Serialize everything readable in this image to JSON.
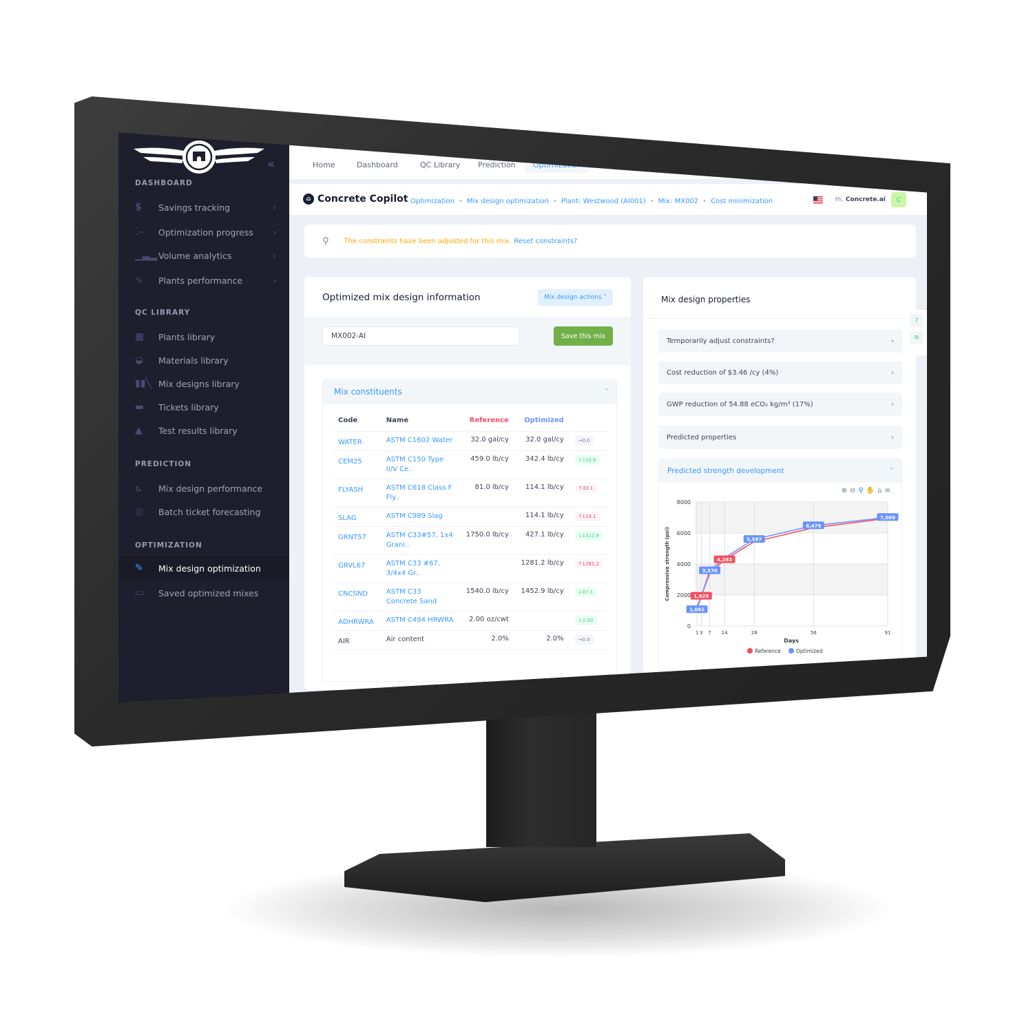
{
  "sidebar": {
    "sections": [
      {
        "title": "DASHBOARD",
        "items": [
          {
            "label": "Savings tracking",
            "icon": "dollar-icon",
            "chevron": true
          },
          {
            "label": "Optimization progress",
            "icon": "progress-icon",
            "chevron": true
          },
          {
            "label": "Volume analytics",
            "icon": "bar-chart-icon",
            "chevron": true
          },
          {
            "label": "Plants performance",
            "icon": "pulse-icon",
            "chevron": true
          }
        ]
      },
      {
        "title": "QC LIBRARY",
        "items": [
          {
            "label": "Plants library",
            "icon": "building-icon"
          },
          {
            "label": "Materials library",
            "icon": "bowl-icon"
          },
          {
            "label": "Mix designs library",
            "icon": "books-icon"
          },
          {
            "label": "Tickets library",
            "icon": "ticket-icon"
          },
          {
            "label": "Test results library",
            "icon": "cone-icon"
          }
        ]
      },
      {
        "title": "PREDICTION",
        "items": [
          {
            "label": "Mix design performance",
            "icon": "line-chart-icon"
          },
          {
            "label": "Batch ticket forecasting",
            "icon": "target-icon"
          }
        ]
      },
      {
        "title": "OPTIMIZATION",
        "items": [
          {
            "label": "Mix design optimization",
            "icon": "pen-icon",
            "active": true
          },
          {
            "label": "Saved optimized mixes",
            "icon": "folder-icon"
          }
        ]
      }
    ],
    "collapse_icon": "«"
  },
  "topnav": {
    "tabs": [
      "Home",
      "Dashboard",
      "QC Library",
      "Prediction",
      "Optimization"
    ],
    "active_tab": "Optimization"
  },
  "header": {
    "brand": "Concrete Copilot",
    "breadcrumb": [
      "Optimization",
      "Mix design optimization",
      "Plant: Westwood (AI001)",
      "Mix: MX002",
      "Cost minimization"
    ],
    "greeting": "Hi,",
    "username": "Concrete.ai",
    "avatar_letter": "C"
  },
  "alert": {
    "text": "The constraints have been adjusted for this mix.",
    "link": "Reset constraints?"
  },
  "mix_info": {
    "title": "Optimized mix design information",
    "actions_label": "Mix design actions",
    "mix_name_value": "MX002-AI",
    "save_label": "Save this mix",
    "constituents_title": "Mix constituents",
    "columns": [
      "Code",
      "Name",
      "Reference",
      "Optimized"
    ],
    "rows": [
      {
        "code": "WATER",
        "name": "ASTM C1602 Water",
        "reference": "32.0 gal/cy",
        "optimized": "32.0 gal/cy",
        "delta": "→0.0",
        "trend": "neutral"
      },
      {
        "code": "CEM25",
        "name": "ASTM C150 Type II/V Ce..",
        "reference": "459.0 lb/cy",
        "optimized": "342.4 lb/cy",
        "delta": "↓116.6",
        "trend": "down"
      },
      {
        "code": "FLYASH",
        "name": "ASTM C618 Class F Fly..",
        "reference": "81.0 lb/cy",
        "optimized": "114.1 lb/cy",
        "delta": "↑33.1",
        "trend": "up"
      },
      {
        "code": "SLAG",
        "name": "ASTM C989 Slag",
        "reference": "",
        "optimized": "114.1 lb/cy",
        "delta": "↑114.1",
        "trend": "up"
      },
      {
        "code": "GRNT57",
        "name": "ASTM C33#57, 1x4 Grani..",
        "reference": "1750.0 lb/cy",
        "optimized": "427.1 lb/cy",
        "delta": "↓1322.9",
        "trend": "down"
      },
      {
        "code": "GRVL67",
        "name": "ASTM C33 #67, 3/4x4 Gr..",
        "reference": "",
        "optimized": "1281.2 lb/cy",
        "delta": "↑1281.2",
        "trend": "up"
      },
      {
        "code": "CNCSND",
        "name": "ASTM C33 Concrete Sand",
        "reference": "1540.0 lb/cy",
        "optimized": "1452.9 lb/cy",
        "delta": "↓87.1",
        "trend": "down"
      },
      {
        "code": "ADHRWRA",
        "name": "ASTM C494 HRWRA",
        "reference": "2.00 oz/cwt",
        "optimized": "",
        "delta": "↓2.00",
        "trend": "down"
      },
      {
        "code": "AIR",
        "name": "Air content",
        "reference": "2.0%",
        "optimized": "2.0%",
        "delta": "→0.0",
        "trend": "neutral",
        "plain": true
      }
    ]
  },
  "properties": {
    "title": "Mix design properties",
    "items": [
      "Temporarily adjust constraints?",
      "Cost reduction of $3.46 /cy (4%)",
      "GWP reduction of 54.88 eCO₂ kg/m³ (17%)",
      "Predicted properties"
    ],
    "strength_title": "Predicted strength development",
    "toolbar": [
      "zoom-in-icon",
      "zoom-out-icon",
      "zoom-select-icon",
      "pan-icon",
      "home-icon",
      "menu-icon"
    ]
  },
  "chart_data": {
    "type": "line",
    "title": "Predicted strength development",
    "xlabel": "Days",
    "ylabel": "Compressive strength (psi)",
    "x": [
      1,
      3,
      7,
      14,
      28,
      56,
      91
    ],
    "x_ticks": [
      "1",
      "3",
      "7",
      "14",
      "28",
      "56",
      "91"
    ],
    "y_ticks": [
      "0",
      "2000",
      "4000",
      "6000",
      "8000"
    ],
    "ylim": [
      0,
      8000
    ],
    "xlim": [
      0,
      91
    ],
    "grid": true,
    "legend_position": "bottom",
    "series": [
      {
        "name": "Reference",
        "color": "#f64e60",
        "values": [
          1200,
          1929,
          3400,
          4283,
          5434,
          6340,
          6950
        ],
        "labels": [
          null,
          "1,929",
          null,
          "4,283",
          null,
          null,
          null
        ]
      },
      {
        "name": "Optimized",
        "color": "#6993ff",
        "values": [
          1061,
          1900,
          3570,
          4400,
          5597,
          6476,
          7009
        ],
        "labels": [
          "1,061",
          null,
          "3,570",
          null,
          "5,597",
          "6,476",
          "7,009"
        ]
      }
    ]
  },
  "side_tools": [
    "help-icon",
    "layers-icon"
  ]
}
